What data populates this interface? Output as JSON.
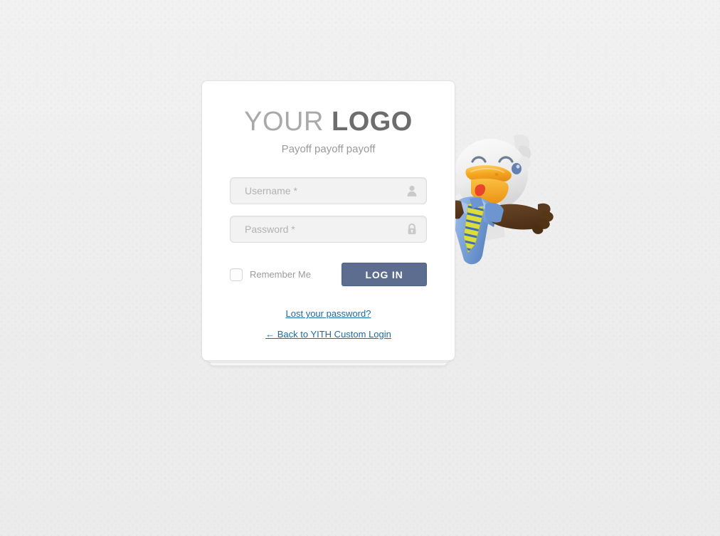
{
  "page": {
    "background_color": "#efefef"
  },
  "card": {
    "logo": {
      "part_light": "YOUR",
      "part_bold": "LOGO",
      "color_light": "#a9a9a9",
      "color_bold": "#6d6d6d"
    },
    "tagline": "Payoff payoff payoff",
    "fields": [
      {
        "name": "username",
        "placeholder": "Username *",
        "value": "",
        "icon": "user-icon"
      },
      {
        "name": "password",
        "placeholder": "Password *",
        "value": "",
        "icon": "lock-icon"
      }
    ],
    "remember": {
      "label": "Remember Me",
      "checked": false
    },
    "submit": {
      "label": "LOG IN",
      "color": "#5d6d8f",
      "text_color": "#ffffff"
    },
    "links": {
      "lost_password": "Lost your password?",
      "back": "← Back to YITH Custom Login",
      "color": "#1a6ba8"
    }
  },
  "mascot": {
    "name": "eagle-mascot",
    "description": "white eagle with orange beak wearing blue shirt and striped tie",
    "colors": {
      "body": "#f0f0f0",
      "body_shade": "#d8d8d8",
      "beak": "#f5a623",
      "beak_light": "#fbc84b",
      "tongue": "#e8442c",
      "shirt": "#7ba2d8",
      "shirt_dark": "#5b84c4",
      "tie": "#e8e84a",
      "arm": "#5a3a1e"
    }
  }
}
